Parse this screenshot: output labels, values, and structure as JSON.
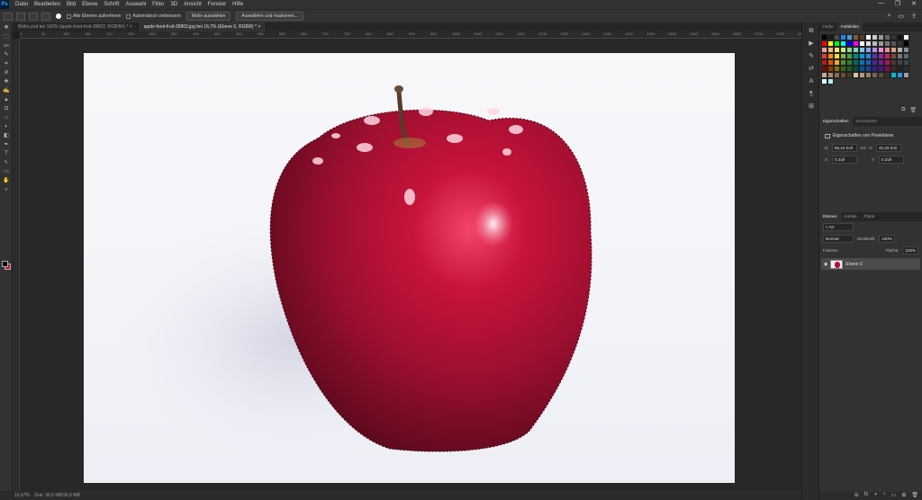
{
  "app": {
    "logo": "Ps"
  },
  "menu": [
    "Datei",
    "Bearbeiten",
    "Bild",
    "Ebene",
    "Schrift",
    "Auswahl",
    "Filter",
    "3D",
    "Ansicht",
    "Fenster",
    "Hilfe"
  ],
  "window_controls": [
    "—",
    "❐",
    "✕"
  ],
  "options": {
    "sample_all": "Alle Ebenen aufnehmen",
    "auto_enhance": "Automatisch verbessern",
    "subject_button": "Motiv auswählen",
    "select_mask_button": "Auswählen und maskieren..."
  },
  "options_right": [
    "⌕",
    "▭",
    "⇪"
  ],
  "tabs": [
    {
      "label": "Bildre.psd bei 100% (apple-food-fruit-39803, RGB/8#) *",
      "close": "×",
      "active": false
    },
    {
      "label": "apple-food-fruit-39803.jpg bei 16,7% (Ebene 0, RGB/8) *",
      "close": "×",
      "active": true
    }
  ],
  "ruler_ticks": [
    "0",
    "50",
    "100",
    "150",
    "200",
    "250",
    "300",
    "350",
    "400",
    "450",
    "500",
    "550",
    "600",
    "650",
    "700",
    "750",
    "800",
    "850",
    "900",
    "950",
    "1000",
    "1050",
    "1100",
    "1150",
    "1200",
    "1250",
    "1300",
    "1350",
    "1400",
    "1450",
    "1500",
    "1550",
    "1600",
    "1650",
    "1700",
    "1750",
    "1800"
  ],
  "tools": [
    "✥",
    "⬚",
    "ᔕ",
    "✎",
    "⌗",
    "⊘",
    "✚",
    "✍",
    "▲",
    "⊡",
    "⌂",
    "◐",
    "◧",
    "✒",
    "T",
    "↖",
    "▭",
    "✋",
    "⌕"
  ],
  "status": {
    "zoom": "16,67%",
    "doc": "Dok: 36,6 MB/36,6 MB"
  },
  "right_strip_icons": [
    "⧉",
    "▶",
    "✎",
    "⇄",
    "A",
    "¶",
    "⊞"
  ],
  "swatch_panel": {
    "tabs": [
      "Farbe",
      "Farbfelder"
    ],
    "colors": [
      "#000000",
      "#1a1a1a",
      "#4b4b4b",
      "#2a7fff",
      "#4a9bd1",
      "#7a5a3a",
      "#5a3a2a",
      "#ffffff",
      "#cccccc",
      "#999999",
      "#666666",
      "#333333",
      "#111111",
      "#ffffff",
      "#ff0000",
      "#ffff00",
      "#00ff00",
      "#00ffff",
      "#0000ff",
      "#ff00ff",
      "#ffffff",
      "#dddddd",
      "#bbbbbb",
      "#999999",
      "#777777",
      "#555555",
      "#333333",
      "#000000",
      "#f39c9c",
      "#f5b97d",
      "#f7e27a",
      "#c9e67f",
      "#8fd48f",
      "#7fd3c1",
      "#7fc3e6",
      "#8f9fe6",
      "#b38fe6",
      "#e68fd1",
      "#e68f9f",
      "#d4a57f",
      "#b0b0b0",
      "#8a8a8a",
      "#e53935",
      "#fb8c00",
      "#fdd835",
      "#7cb342",
      "#43a047",
      "#00897b",
      "#039be5",
      "#1e88e5",
      "#5e35b1",
      "#8e24aa",
      "#d81b60",
      "#6d4c41",
      "#757575",
      "#546e7a",
      "#b71c1c",
      "#e65100",
      "#f9a825",
      "#558b2f",
      "#2e7d32",
      "#00695c",
      "#0277bd",
      "#1565c0",
      "#4527a0",
      "#6a1b9a",
      "#ad1457",
      "#4e342e",
      "#424242",
      "#37474f",
      "#7f0000",
      "#8d3b00",
      "#8d6e00",
      "#33691e",
      "#1b5e20",
      "#004d40",
      "#01579b",
      "#0d47a1",
      "#311b92",
      "#4a148c",
      "#880e4f",
      "#3e2723",
      "#212121",
      "#263238",
      "#c8a98a",
      "#a9876a",
      "#8a6a4e",
      "#6b4f38",
      "#4d3826",
      "#d7c3b0",
      "#b89a7e",
      "#998066",
      "#7a6451",
      "#5b4a3c",
      "#3c2f25",
      "#00bcd4",
      "#2196f3",
      "#9e9e9e",
      "#e0f7fa",
      "#b2ebf2"
    ]
  },
  "properties": {
    "tabs": [
      "Eigenschaften",
      "Korrekturen"
    ],
    "title": "Eigenschaften von Pixelebene",
    "w_label": "B:",
    "w_value": "66,44 Zoll",
    "link": "GO",
    "h_label": "H:",
    "h_value": "45,33 Zoll",
    "x_label": "X:",
    "x_value": "0 Zoll",
    "y_label": "Y:",
    "y_value": "0 Zoll"
  },
  "layers": {
    "tabs": [
      "Ebenen",
      "Kanäle",
      "Pfade"
    ],
    "filter": "⌕ Art",
    "blend": "Normal",
    "opacity_label": "Deckkraft:",
    "opacity_value": "100%",
    "lock_label": "Fixieren:",
    "fill_label": "Fläche:",
    "fill_value": "100%",
    "rows": [
      {
        "name": "Ebene 0",
        "eye": "◉"
      }
    ],
    "bottom_icons": [
      "⊖",
      "fx",
      "◑",
      "◔",
      "▭",
      "⊞",
      "🗑"
    ]
  },
  "panel_small_icons": [
    "⧉",
    "🗑"
  ]
}
